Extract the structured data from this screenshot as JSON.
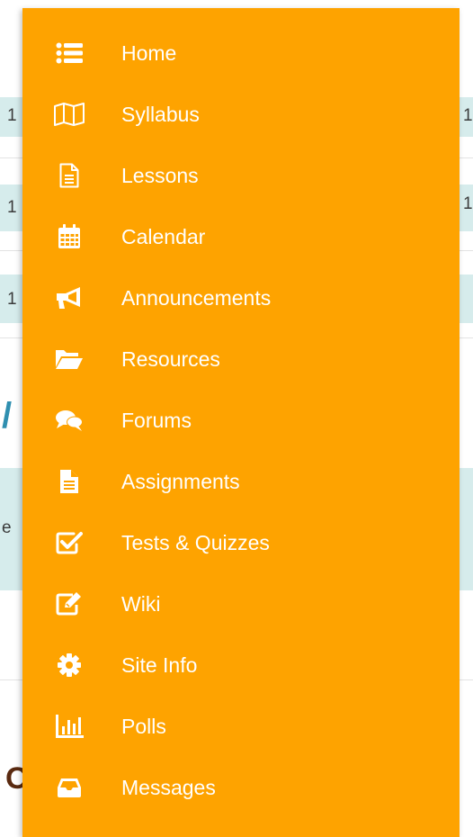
{
  "background": {
    "fragments": [
      "1",
      "1",
      "1",
      "1",
      "1",
      "/",
      "e",
      "O"
    ]
  },
  "menu": {
    "items": [
      {
        "label": "Home",
        "icon": "list-icon"
      },
      {
        "label": "Syllabus",
        "icon": "map-icon"
      },
      {
        "label": "Lessons",
        "icon": "document-icon"
      },
      {
        "label": "Calendar",
        "icon": "calendar-icon"
      },
      {
        "label": "Announcements",
        "icon": "megaphone-icon"
      },
      {
        "label": "Resources",
        "icon": "folder-open-icon"
      },
      {
        "label": "Forums",
        "icon": "chat-bubbles-icon"
      },
      {
        "label": "Assignments",
        "icon": "file-text-icon"
      },
      {
        "label": "Tests & Quizzes",
        "icon": "checkbox-icon"
      },
      {
        "label": "Wiki",
        "icon": "edit-icon"
      },
      {
        "label": "Site Info",
        "icon": "gear-icon"
      },
      {
        "label": "Polls",
        "icon": "bar-chart-icon"
      },
      {
        "label": "Messages",
        "icon": "inbox-icon"
      }
    ],
    "colors": {
      "background": "#fea300",
      "text": "#ffffff"
    }
  }
}
